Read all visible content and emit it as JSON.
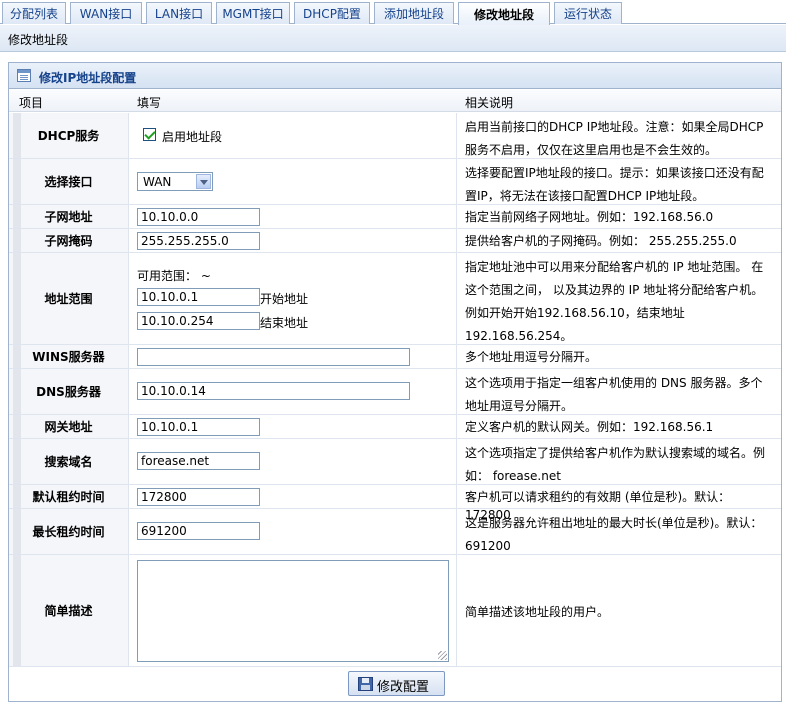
{
  "tabs": [
    {
      "label": "分配列表"
    },
    {
      "label": "WAN接口"
    },
    {
      "label": "LAN接口"
    },
    {
      "label": "MGMT接口"
    },
    {
      "label": "DHCP配置"
    },
    {
      "label": "添加地址段"
    },
    {
      "label": "修改地址段"
    },
    {
      "label": "运行状态"
    }
  ],
  "page_title": "修改地址段",
  "panel_title": "修改IP地址段配置",
  "columns": {
    "item": "项目",
    "fill": "填写",
    "desc": "相关说明"
  },
  "rows": {
    "dhcp": {
      "label": "DHCP服务",
      "checkbox_label": "启用地址段",
      "desc": "启用当前接口的DHCP IP地址段。注意：如果全局DHCP服务不启用，仅仅在这里启用也是不会生效的。"
    },
    "iface": {
      "label": "选择接口",
      "value": "WAN",
      "desc": "选择要配置IP地址段的接口。提示：如果该接口还没有配置IP，将无法在该接口配置DHCP IP地址段。"
    },
    "subnet": {
      "label": "子网地址",
      "value": "10.10.0.0",
      "desc": "指定当前网络子网地址。例如：192.168.56.0"
    },
    "mask": {
      "label": "子网掩码",
      "value": "255.255.255.0",
      "desc": "提供给客户机的子网掩码。例如： 255.255.255.0"
    },
    "range": {
      "label": "地址范围",
      "available": "可用范围： ~",
      "start_value": "10.10.0.1",
      "start_label": "开始地址",
      "end_value": "10.10.0.254",
      "end_label": "结束地址",
      "desc": "指定地址池中可以用来分配给客户机的 IP 地址范围。 在这个范围之间， 以及其边界的 IP 地址将分配给客户机。例如开始开始192.168.56.10，结束地址192.168.56.254。"
    },
    "wins": {
      "label": "WINS服务器",
      "value": "",
      "desc": "多个地址用逗号分隔开。"
    },
    "dns": {
      "label": "DNS服务器",
      "value": "10.10.0.14",
      "desc": "这个选项用于指定一组客户机使用的 DNS 服务器。多个地址用逗号分隔开。"
    },
    "gateway": {
      "label": "网关地址",
      "value": "10.10.0.1",
      "desc": "定义客户机的默认网关。例如：192.168.56.1"
    },
    "domain": {
      "label": "搜索域名",
      "value": "forease.net",
      "desc": "这个选项指定了提供给客户机作为默认搜索域的域名。例如： forease.net"
    },
    "default_lease": {
      "label": "默认租约时间",
      "value": "172800",
      "desc": "客户机可以请求租约的有效期 (单位是秒)。默认：172800"
    },
    "max_lease": {
      "label": "最长租约时间",
      "value": "691200",
      "desc": "这是服务器允许租出地址的最大时长(单位是秒)。默认：691200"
    },
    "note": {
      "label": "简单描述",
      "value": "",
      "desc": "简单描述该地址段的用户。"
    }
  },
  "submit_label": "修改配置",
  "active_tab": "修改地址段"
}
